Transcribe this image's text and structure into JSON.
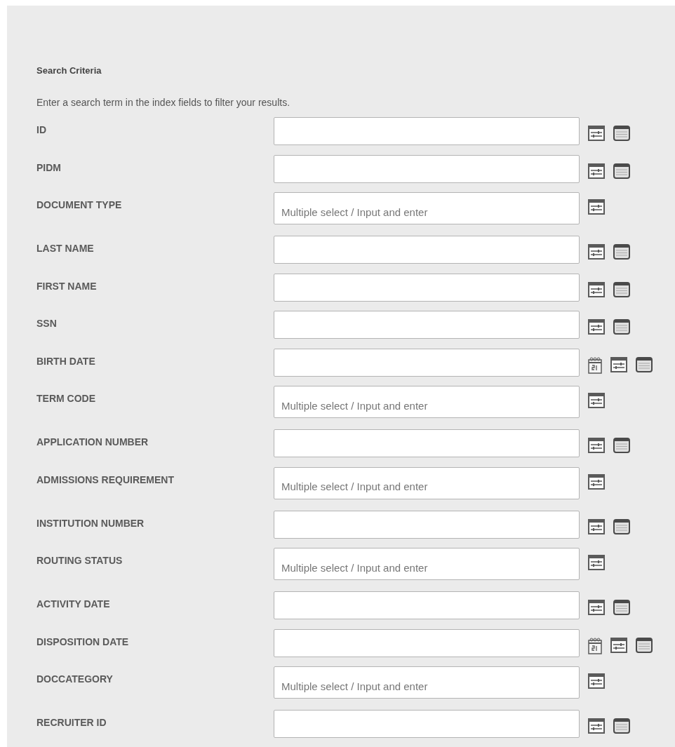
{
  "title": "Search Criteria",
  "instructions": "Enter a search term in the index fields to filter your results.",
  "fields": [
    {
      "label": "ID",
      "kind": "text"
    },
    {
      "label": "PIDM",
      "kind": "text"
    },
    {
      "label": "DOCUMENT TYPE",
      "kind": "multi",
      "placeholder": "Multiple select / Input and enter"
    },
    {
      "label": "LAST NAME",
      "kind": "text"
    },
    {
      "label": "FIRST NAME",
      "kind": "text"
    },
    {
      "label": "SSN",
      "kind": "text"
    },
    {
      "label": "BIRTH DATE",
      "kind": "date"
    },
    {
      "label": "TERM CODE",
      "kind": "multi",
      "placeholder": "Multiple select / Input and enter"
    },
    {
      "label": "APPLICATION NUMBER",
      "kind": "text"
    },
    {
      "label": "ADMISSIONS REQUIREMENT",
      "kind": "multi",
      "placeholder": "Multiple select / Input and enter"
    },
    {
      "label": "INSTITUTION NUMBER",
      "kind": "text"
    },
    {
      "label": "ROUTING STATUS",
      "kind": "multi",
      "placeholder": "Multiple select / Input and enter"
    },
    {
      "label": "ACTIVITY DATE",
      "kind": "text"
    },
    {
      "label": "DISPOSITION DATE",
      "kind": "date"
    },
    {
      "label": "DOCCATEGORY",
      "kind": "multi",
      "placeholder": "Multiple select / Input and enter"
    },
    {
      "label": "RECRUITER ID",
      "kind": "text"
    }
  ]
}
